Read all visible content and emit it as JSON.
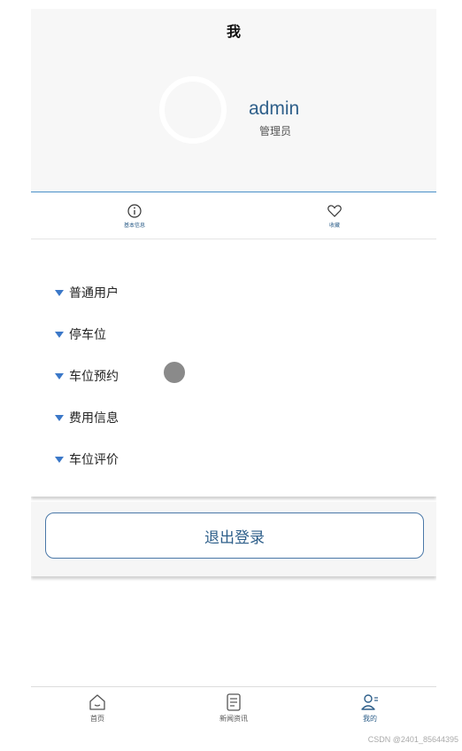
{
  "header": {
    "title": "我",
    "username": "admin",
    "role": "管理员"
  },
  "tabs": [
    {
      "label": "基本信息",
      "icon": "info-icon"
    },
    {
      "label": "收藏",
      "icon": "heart-icon"
    }
  ],
  "menu": {
    "items": [
      {
        "label": "普通用户"
      },
      {
        "label": "停车位"
      },
      {
        "label": "车位预约"
      },
      {
        "label": "费用信息"
      },
      {
        "label": "车位评价"
      }
    ]
  },
  "logout": {
    "label": "退出登录"
  },
  "bottom_nav": {
    "items": [
      {
        "label": "首页",
        "icon": "home-icon",
        "active": false
      },
      {
        "label": "新闻资讯",
        "icon": "news-icon",
        "active": false
      },
      {
        "label": "我的",
        "icon": "user-icon",
        "active": true
      }
    ]
  },
  "colors": {
    "accent": "#2e5f8a",
    "triangle": "#3b78c8",
    "header_bg": "#f7f7f7"
  },
  "watermark": "CSDN @2401_85644395"
}
